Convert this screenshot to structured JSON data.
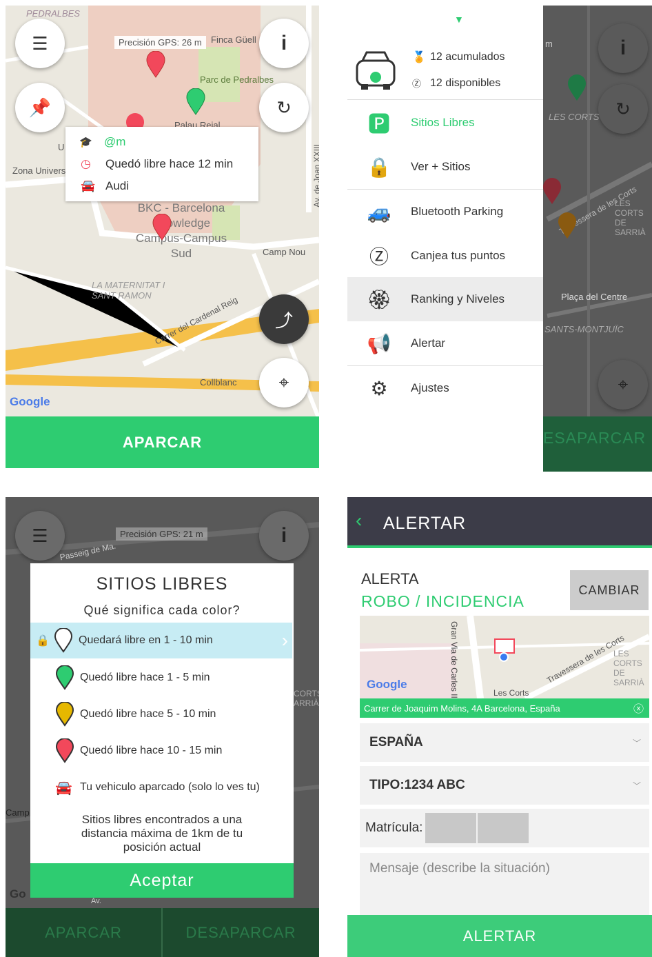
{
  "panel1": {
    "gps_label": "Precisión GPS: 26 m",
    "map_labels": [
      "PEDRALBES",
      "Finca Güell",
      "Parc de Pedralbes",
      "Palau Reial",
      "Zona Universi",
      "BKC - Barcelona Knowledge Campus-Campus Sud",
      "Camp Nou",
      "LA MATERNITAT I SANT RAMON",
      "Carrer del Cardenal Reig",
      "Collblanc",
      "Av. de Joan XXIII",
      "U"
    ],
    "popup": {
      "user": "@m",
      "time": "Quedó libre hace 12 min",
      "car": "Audi"
    },
    "google": "Google",
    "bottom_button": "APARCAR"
  },
  "panel2": {
    "accumulated": "12 acumulados",
    "available": "12 disponibles",
    "menu": [
      {
        "label": "Sitios Libres",
        "icon": "parking-pin-icon",
        "active": true
      },
      {
        "label": "Ver + Sitios",
        "icon": "lock-pin-icon"
      },
      {
        "label": "Bluetooth Parking",
        "icon": "bluetooth-car-icon"
      },
      {
        "label": "Canjea tus puntos",
        "icon": "points-coin-icon"
      },
      {
        "label": "Ranking y Niveles",
        "icon": "ranking-badge-icon"
      },
      {
        "label": "Alertar",
        "icon": "megaphone-icon"
      },
      {
        "label": "Ajustes",
        "icon": "gear-icon"
      }
    ],
    "map_labels": [
      "LES CORTS",
      "Travessera de les Corts",
      "LES CORTS DE SARRIÀ",
      "Plaça del Centre",
      "SANTS-MONTJUÏC",
      "m"
    ],
    "bottom_button": "ESAPARCAR"
  },
  "panel3": {
    "gps_label": "Precisión GPS: 21 m",
    "map_labels": [
      "Passeig de Ma.",
      "Camp Nou",
      "CORTS ARRIÀ",
      "Go",
      "Av."
    ],
    "dialog": {
      "title": "SITIOS LIBRES",
      "subtitle": "Qué significa cada color?",
      "rows": [
        {
          "label": "Quedará libre en 1 - 10 min",
          "color": "#ffffff"
        },
        {
          "label": "Quedó libre hace 1 - 5 min",
          "color": "#2ecc71"
        },
        {
          "label": "Quedó libre hace 5 - 10 min",
          "color": "#e6b800"
        },
        {
          "label": "Quedó libre hace 10 - 15 min",
          "color": "#f2485b"
        },
        {
          "label": "Tu vehiculo aparcado (solo lo ves tu)",
          "color": "#f2485b"
        }
      ],
      "note": "Sitios libres encontrados a una distancia máxima de 1km de tu posición actual",
      "accept": "Aceptar"
    },
    "bottom_left": "APARCAR",
    "bottom_right": "DESAPARCAR"
  },
  "panel4": {
    "title": "ALERTAR",
    "alert_label": "ALERTA",
    "alert_type": "ROBO / INCIDENCIA",
    "change_button": "CAMBIAR",
    "map_labels": [
      "Gran Via de Carles III",
      "Travessera de les Corts",
      "LES CORTS DE SARRIÀ",
      "Les Corts"
    ],
    "google": "Google",
    "address": "Carrer de Joaquim Molins, 4A Barcelona, España",
    "country": "ESPAÑA",
    "type": "TIPO:1234 ABC",
    "plate_label": "Matrícula:",
    "message_placeholder": "Mensaje (describe la situación)",
    "submit": "ALERTAR"
  },
  "colors": {
    "green": "#2ecc71",
    "dark_header": "#3c3c48",
    "red_pin": "#f2485b"
  }
}
